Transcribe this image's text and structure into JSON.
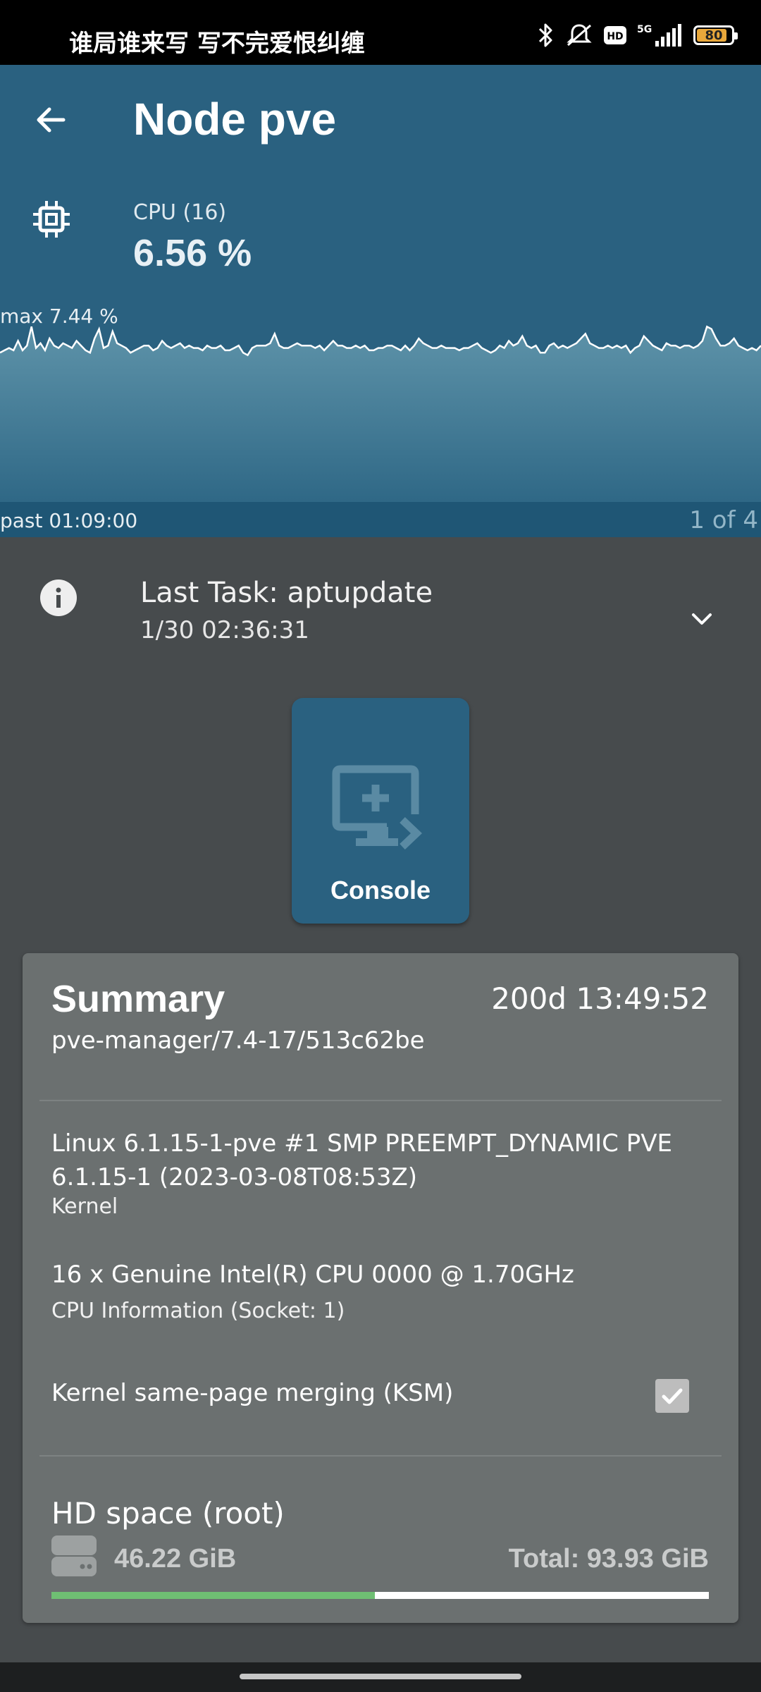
{
  "status_bar": {
    "text": "谁局谁来写 写不完爱恨纠缠",
    "battery": "80",
    "icons": [
      "bluetooth-icon",
      "mute-icon",
      "hd-icon",
      "5g-signal-icon",
      "battery-icon"
    ]
  },
  "header": {
    "title": "Node pve",
    "cpu_label": "CPU (16)",
    "cpu_value": "6.56 %",
    "max_label": "max 7.44 %",
    "time_range": "past 01:09:00",
    "page_indicator": "1 of 4"
  },
  "chart_data": {
    "type": "area",
    "title": "",
    "xlabel": "",
    "ylabel": "",
    "ylim": [
      0,
      7.44
    ],
    "values": [
      6.3,
      6.4,
      6.5,
      6.4,
      6.8,
      6.4,
      6.6,
      7.4,
      6.5,
      6.7,
      6.4,
      6.9,
      6.6,
      6.5,
      6.7,
      6.6,
      6.5,
      6.8,
      6.6,
      6.4,
      6.3,
      6.9,
      7.3,
      6.5,
      6.6,
      7.2,
      6.7,
      6.6,
      6.5,
      6.3,
      6.4,
      6.5,
      6.6,
      6.6,
      6.4,
      6.5,
      6.8,
      6.6,
      6.5,
      6.6,
      6.7,
      6.5,
      6.6,
      6.5,
      6.5,
      6.4,
      6.6,
      6.5,
      6.5,
      6.6,
      6.4,
      6.4,
      6.5,
      6.6,
      6.3,
      6.2,
      6.5,
      6.6,
      6.6,
      6.6,
      6.7,
      7.1,
      6.6,
      6.5,
      6.5,
      6.6,
      6.7,
      6.6,
      6.6,
      6.6,
      6.5,
      6.6,
      6.4,
      6.6,
      6.8,
      6.6,
      6.6,
      6.5,
      6.5,
      6.6,
      6.5,
      6.6,
      6.4,
      6.4,
      6.5,
      6.5,
      6.6,
      6.6,
      6.5,
      6.4,
      6.6,
      6.4,
      6.6,
      6.9,
      6.7,
      6.6,
      6.5,
      6.5,
      6.6,
      6.5,
      6.5,
      6.5,
      6.4,
      6.5,
      6.5,
      6.6,
      6.7,
      6.5,
      6.4,
      6.3,
      6.4,
      6.6,
      6.5,
      6.8,
      6.6,
      6.7,
      7.0,
      6.6,
      6.5,
      6.6,
      6.3,
      6.3,
      6.6,
      6.7,
      6.5,
      6.6,
      6.5,
      6.6,
      6.7,
      6.9,
      7.1,
      6.7,
      6.6,
      6.5,
      6.5,
      6.6,
      6.5,
      6.6,
      6.5,
      6.6,
      6.3,
      6.5,
      6.6,
      7.0,
      6.8,
      6.6,
      6.5,
      6.4,
      6.7,
      6.6,
      6.6,
      6.5,
      6.6,
      6.6,
      6.5,
      6.6,
      6.8,
      7.4,
      7.3,
      6.9,
      6.6,
      6.6,
      6.7,
      6.9,
      6.6,
      6.5,
      6.4,
      6.5,
      6.4,
      6.6
    ]
  },
  "last_task": {
    "title": "Last Task: aptupdate",
    "time": "1/30 02:36:31"
  },
  "console": {
    "label": "Console"
  },
  "summary": {
    "title": "Summary",
    "uptime": "200d 13:49:52",
    "version": "pve-manager/7.4-17/513c62be",
    "kernel_value": "Linux 6.1.15-1-pve #1 SMP PREEMPT_DYNAMIC PVE 6.1.15-1 (2023-03-08T08:53Z)",
    "kernel_label": "Kernel",
    "cpu_value": "16 x Genuine Intel(R) CPU 0000 @ 1.70GHz",
    "cpu_label": "CPU Information (Socket: 1)",
    "ksm_label": "Kernel same-page merging (KSM)",
    "ksm_enabled": true,
    "hd_title": "HD space (root)",
    "hd_used": "46.22 GiB",
    "hd_total": "Total: 93.93 GiB",
    "hd_fraction": 0.492
  },
  "colors": {
    "header_bg": "#2a6180",
    "page_bg": "#474b4d",
    "card_bg": "#6b7070",
    "progress_fill": "#6fbf73"
  }
}
